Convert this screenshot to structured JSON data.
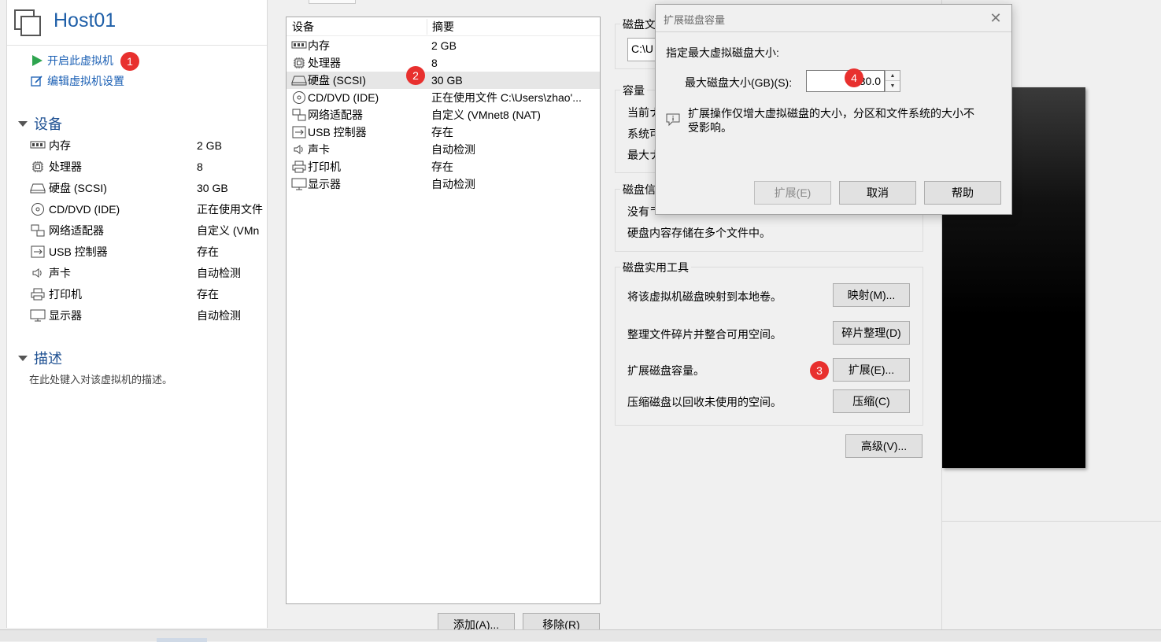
{
  "vm": {
    "name": "Host01",
    "actions": [
      {
        "label": "开启此虚拟机",
        "icon": "play-icon"
      },
      {
        "label": "编辑虚拟机设置",
        "icon": "edit-settings-icon"
      }
    ]
  },
  "left": {
    "devices_heading": "设备",
    "devices": [
      {
        "name": "内存",
        "value": "2 GB",
        "icon": "memory-icon"
      },
      {
        "name": "处理器",
        "value": "8",
        "icon": "processor-icon"
      },
      {
        "name": "硬盘 (SCSI)",
        "value": "30 GB",
        "icon": "hard-disk-icon"
      },
      {
        "name": "CD/DVD (IDE)",
        "value": "正在使用文件",
        "icon": "cd-dvd-icon"
      },
      {
        "name": "网络适配器",
        "value": "自定义 (VMn",
        "icon": "network-adapter-icon"
      },
      {
        "name": "USB 控制器",
        "value": "存在",
        "icon": "usb-icon"
      },
      {
        "name": "声卡",
        "value": "自动检测",
        "icon": "sound-card-icon"
      },
      {
        "name": "打印机",
        "value": "存在",
        "icon": "printer-icon"
      },
      {
        "name": "显示器",
        "value": "自动检测",
        "icon": "display-icon"
      }
    ],
    "description_heading": "描述",
    "description_placeholder": "在此处键入对该虚拟机的描述。"
  },
  "device_list": {
    "col_device": "设备",
    "col_summary": "摘要",
    "rows": [
      {
        "name": "内存",
        "summary": "2 GB",
        "icon": "memory-icon"
      },
      {
        "name": "处理器",
        "summary": "8",
        "icon": "processor-icon"
      },
      {
        "name": "硬盘 (SCSI)",
        "summary": "30 GB",
        "icon": "hard-disk-icon"
      },
      {
        "name": "CD/DVD (IDE)",
        "summary": "正在使用文件 C:\\Users\\zhao'...",
        "icon": "cd-dvd-icon"
      },
      {
        "name": "网络适配器",
        "summary": "自定义 (VMnet8 (NAT)",
        "icon": "network-adapter-icon"
      },
      {
        "name": "USB 控制器",
        "summary": "存在",
        "icon": "usb-icon"
      },
      {
        "name": "声卡",
        "summary": "自动检测",
        "icon": "sound-card-icon"
      },
      {
        "name": "打印机",
        "summary": "存在",
        "icon": "printer-icon"
      },
      {
        "name": "显示器",
        "summary": "自动检测",
        "icon": "display-icon"
      }
    ],
    "add_button": "添加(A)...",
    "remove_button": "移除(R)"
  },
  "disk_panel": {
    "disk_file_title": "磁盘文",
    "disk_file_path": "C:\\U",
    "capacity_title": "容量",
    "capacity_lines": [
      "当前ナ",
      "系统可",
      "最大ナ"
    ],
    "disk_info_title": "磁盘信",
    "disk_info_lines": [
      "没有ᄏ",
      "硬盘内容存储在多个文件中。"
    ],
    "utilities_title": "磁盘实用工具",
    "utilities": [
      {
        "text": "将该虚拟机磁盘映射到本地卷。",
        "button": "映射(M)..."
      },
      {
        "text": "整理文件碎片并整合可用空间。",
        "button": "碎片整理(D)"
      },
      {
        "text": "扩展磁盘容量。",
        "button": "扩展(E)..."
      },
      {
        "text": "压缩磁盘以回收未使用的空间。",
        "button": "压缩(C)"
      }
    ],
    "advanced_button": "高级(V)..."
  },
  "dialog": {
    "title": "扩展磁盘容量",
    "close_glyph": "✕",
    "instruction": "指定最大虚拟磁盘大小:",
    "size_label": "最大磁盘大小(GB)(S):",
    "size_value": "30.0",
    "info_line1": "扩展操作仅增大虚拟磁盘的大小，分区和文件系统的大小不",
    "info_line2": "受影响。",
    "expand_button": "扩展(E)",
    "cancel_button": "取消",
    "help_button": "帮助"
  },
  "badges": [
    "1",
    "2",
    "3",
    "4"
  ],
  "colors": {
    "accent": "#1a5fb4",
    "badge": "#e8302e",
    "play": "#2ea44f"
  }
}
